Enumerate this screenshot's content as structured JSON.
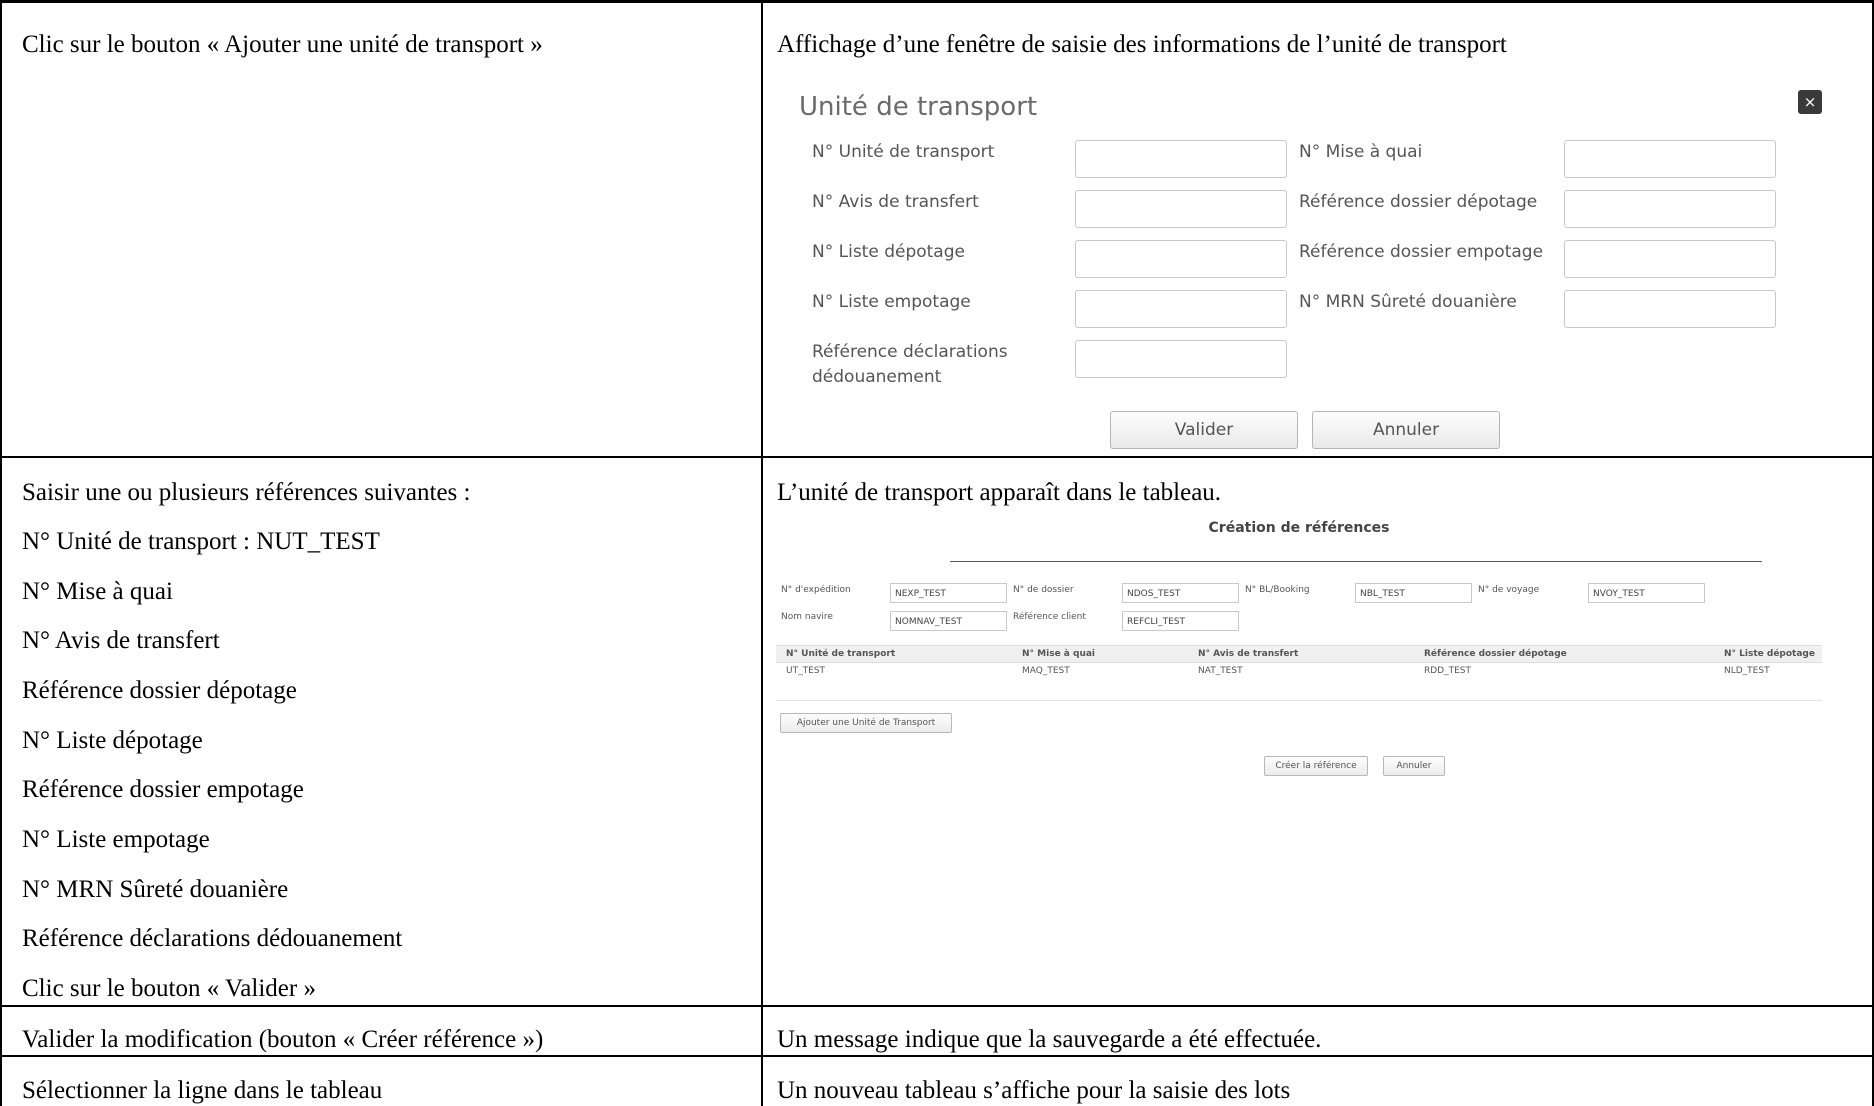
{
  "rows": [
    {
      "left": [
        "Clic sur le bouton « Ajouter une unité de transport »"
      ],
      "right": "Affichage d’une fenêtre de saisie des informations de l’unité de transport"
    },
    {
      "left": [
        "Saisir une ou plusieurs références suivantes :",
        "N° Unité de transport : NUT_TEST",
        "N° Mise à quai",
        "N° Avis de transfert",
        "Référence dossier dépotage",
        "N° Liste dépotage",
        "Référence dossier empotage",
        "N° Liste empotage",
        "N° MRN Sûreté douanière",
        "Référence déclarations dédouanement",
        "Clic sur le bouton « Valider »"
      ],
      "right": "L’unité de transport apparaît dans le tableau."
    },
    {
      "left": [
        "Valider la modification (bouton « Créer référence »)"
      ],
      "right": "Un message indique que la sauvegarde a été effectuée."
    },
    {
      "left": [
        "Sélectionner la ligne dans le tableau"
      ],
      "right": "Un nouveau tableau s’affiche pour la saisie des lots"
    }
  ],
  "modal": {
    "title": "Unité de transport",
    "close": "×",
    "fields_left": [
      "N° Unité de transport",
      "N° Avis de transfert",
      "N° Liste dépotage",
      "N° Liste empotage",
      "Référence déclarations dédouanement"
    ],
    "fields_right": [
      "N° Mise à quai",
      "Référence dossier dépotage",
      "Référence dossier empotage",
      "N° MRN Sûreté douanière"
    ],
    "validate": "Valider",
    "cancel": "Annuler"
  },
  "screenshot": {
    "title": "Création de références",
    "fields": [
      {
        "label": "N° d'expédition",
        "value": "NEXP_TEST"
      },
      {
        "label": "N° de dossier",
        "value": "NDOS_TEST"
      },
      {
        "label": "N° BL/Booking",
        "value": "NBL_TEST"
      },
      {
        "label": "N° de voyage",
        "value": "NVOY_TEST"
      },
      {
        "label": "Nom navire",
        "value": "NOMNAV_TEST"
      },
      {
        "label": "Référence client",
        "value": "REFCLI_TEST"
      }
    ],
    "table_headers": [
      "N° Unité de transport",
      "N° Mise à quai",
      "N° Avis de transfert",
      "Référence dossier dépotage",
      "N° Liste dépotage"
    ],
    "table_row": [
      "UT_TEST",
      "MAQ_TEST",
      "NAT_TEST",
      "RDD_TEST",
      "NLD_TEST"
    ],
    "add_button": "Ajouter une Unité de Transport",
    "create_button": "Créer la référence",
    "cancel_button": "Annuler"
  }
}
